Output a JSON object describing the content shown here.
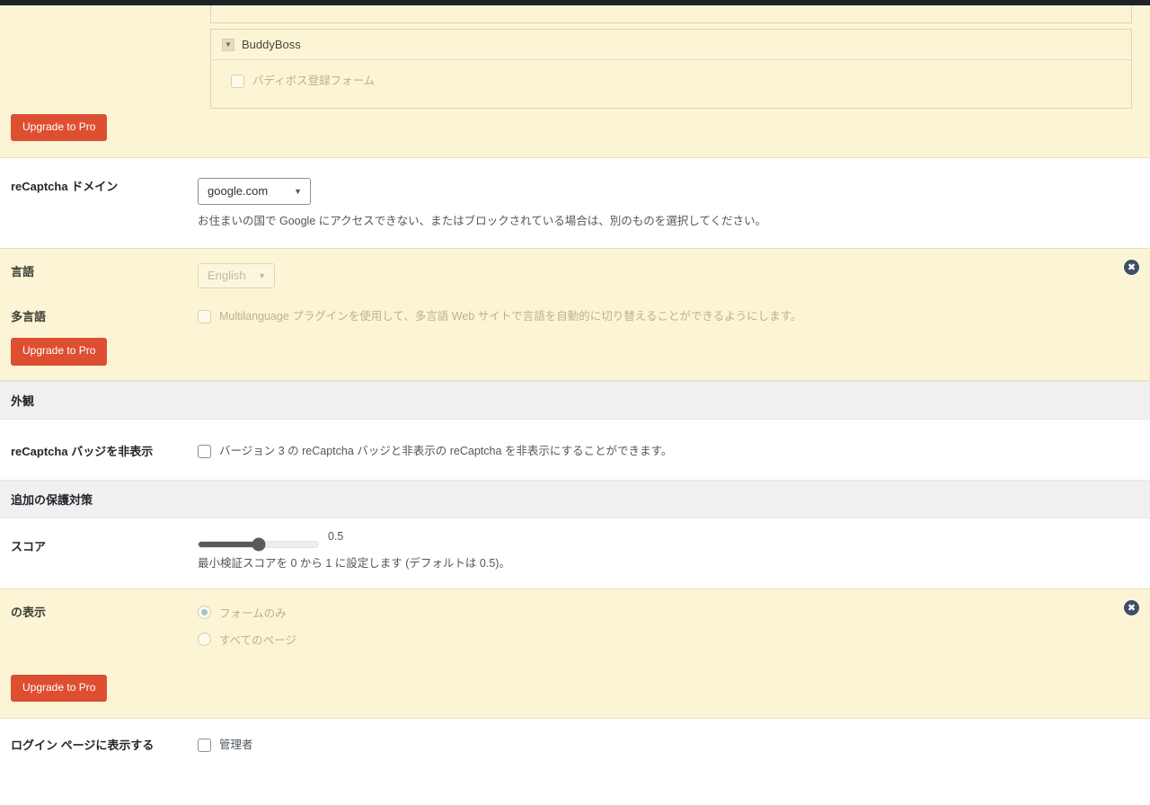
{
  "forms_panel": {
    "buddyboss": {
      "title": "BuddyBoss",
      "caret_icon": "caret-down-icon",
      "items": [
        {
          "label": "バディボス登録フォーム",
          "checked": false
        }
      ]
    },
    "upgrade_label": "Upgrade to Pro"
  },
  "domain_row": {
    "label": "reCaptcha ドメイン",
    "selected": "google.com",
    "caret_icon": "chevron-down-icon",
    "description": "お住まいの国で Google にアクセスできない、またはブロックされている場合は、別のものを選択してください。"
  },
  "language_block": {
    "close_icon": "close-circle-icon",
    "language": {
      "label": "言語",
      "selected": "English",
      "caret_icon": "chevron-down-icon"
    },
    "multilanguage": {
      "label": "多言語",
      "checkbox_text": "Multilanguage プラグインを使用して、多言語 Web サイトで言語を自動的に切り替えることができるようにします。",
      "checked": false
    },
    "upgrade_label": "Upgrade to Pro"
  },
  "appearance_section": {
    "heading": "外観",
    "hide_badge": {
      "label": "reCaptcha バッジを非表示",
      "checkbox_text": "バージョン 3 の reCaptcha バッジと非表示の reCaptcha を非表示にすることができます。",
      "checked": false
    }
  },
  "protection_section": {
    "heading": "追加の保護対策",
    "score": {
      "label": "スコア",
      "value": "0.5",
      "percent": 50,
      "description": "最小検証スコアを 0 から 1 に設定します (デフォルトは 0.5)。"
    },
    "display_block": {
      "close_icon": "close-circle-icon",
      "label": "の表示",
      "options": [
        {
          "label": "フォームのみ",
          "selected": true
        },
        {
          "label": "すべてのページ",
          "selected": false
        }
      ],
      "upgrade_label": "Upgrade to Pro"
    }
  },
  "bottom_row": {
    "label": "ログイン ページに表示する",
    "checkbox_text": "管理者",
    "checked": false
  },
  "colors": {
    "pro_background": "#fbf5d6",
    "upgrade_button": "#dd4f30",
    "section_header": "#f0f0f1",
    "close_badge": "#3f4f68",
    "radio_selected": "#9fc5cf",
    "slider_fill": "#5a5a5a"
  }
}
